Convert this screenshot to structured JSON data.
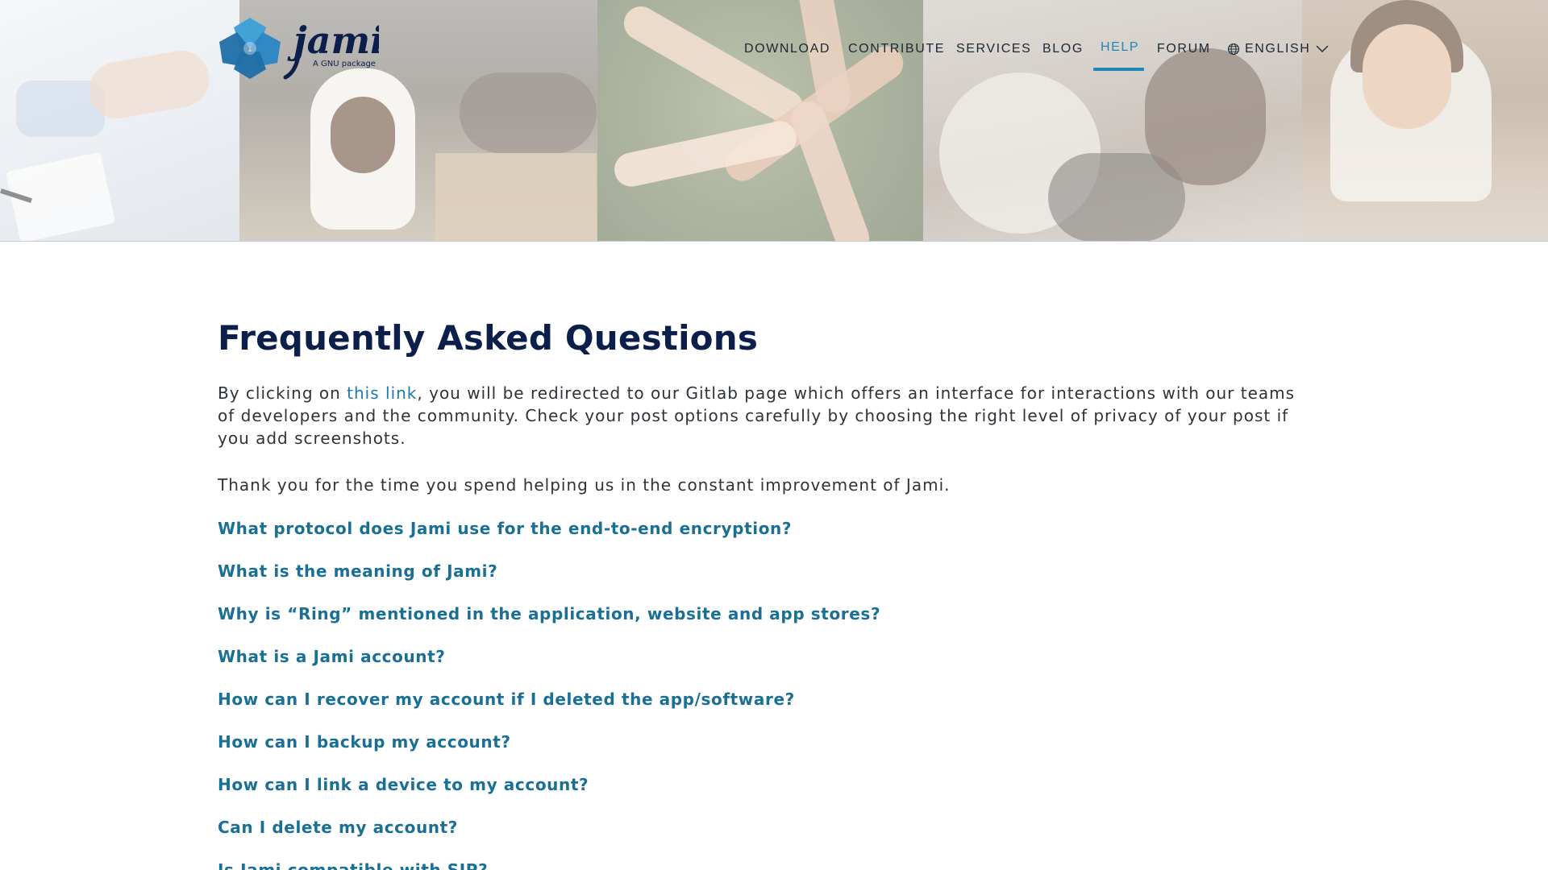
{
  "brand": {
    "name": "jami",
    "tagline": "A GNU package",
    "colors": {
      "mark_dark": "#1f6fa8",
      "mark_light": "#3aa0d8",
      "wordmark": "#0c1f4a"
    }
  },
  "nav": {
    "items": [
      {
        "label": "DOWNLOAD",
        "active": false
      },
      {
        "label": "CONTRIBUTE",
        "active": false
      },
      {
        "label": "SERVICES",
        "active": false
      },
      {
        "label": "BLOG",
        "active": false
      },
      {
        "label": "HELP",
        "active": true
      },
      {
        "label": "FORUM",
        "active": false
      }
    ],
    "language": {
      "label": "ENGLISH",
      "icon": "globe-icon",
      "caret_icon": "chevron-down-icon"
    },
    "accent_color": "#1f86b8"
  },
  "page": {
    "title": "Frequently Asked Questions",
    "intro_before_link": "By clicking on ",
    "intro_link": "this link",
    "intro_after_link": ", you will be redirected to our Gitlab page which offers an interface for interactions with our teams of developers and the community. Check your post options carefully by choosing the right level of privacy of your post if you add screenshots.",
    "thanks": "Thank you for the time you spend helping us in the constant improvement of Jami."
  },
  "faq": [
    "What protocol does Jami use for the end-to-end encryption?",
    "What is the meaning of Jami?",
    "Why is “Ring” mentioned in the application, website and app stores?",
    "What is a Jami account?",
    "How can I recover my account if I deleted the app/software?",
    "How can I backup my account?",
    "How can I link a device to my account?",
    "Can I delete my account?",
    "Is Jami compatible with SIP?"
  ]
}
